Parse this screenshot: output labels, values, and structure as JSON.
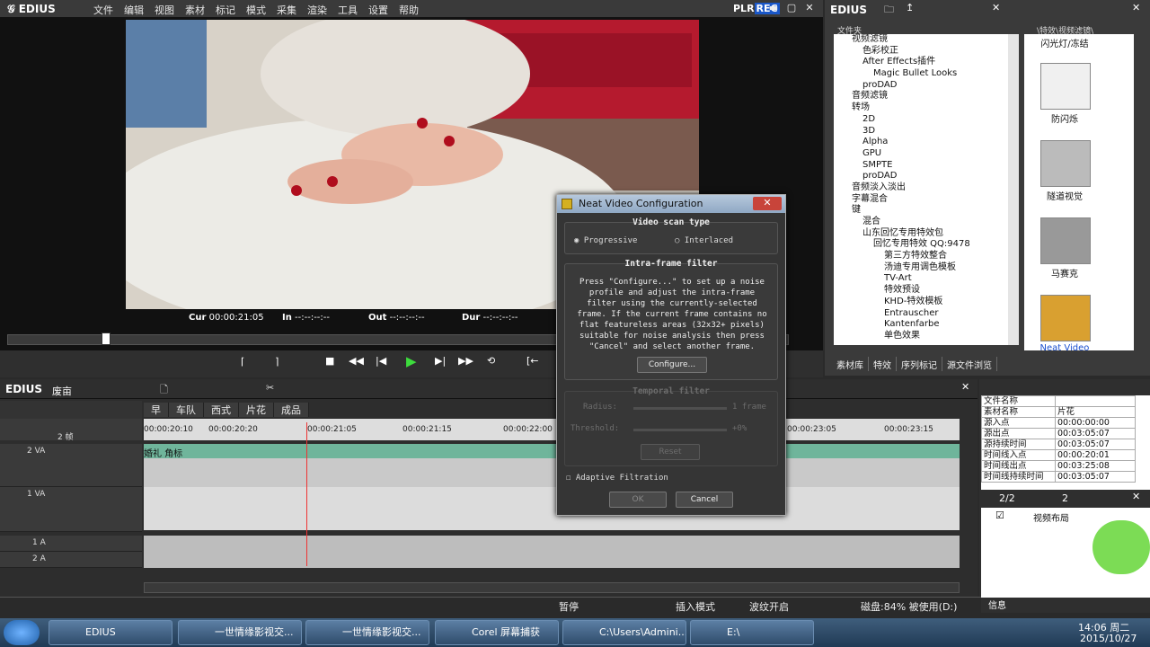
{
  "app": {
    "name": "EDIUS"
  },
  "menu": [
    "文件",
    "编辑",
    "视图",
    "素材",
    "标记",
    "模式",
    "采集",
    "渲染",
    "工具",
    "设置",
    "帮助"
  ],
  "preview": {
    "plr_label": "PLR",
    "rec_label": "REC",
    "cur_label": "Cur",
    "cur_value": "00:00:21:05",
    "in_label": "In",
    "in_value": "--:--:--:--",
    "out_label": "Out",
    "out_value": "--:--:--:--",
    "dur_label": "Dur",
    "dur_value": "--:--:--:--"
  },
  "effects": {
    "title": "EDIUS",
    "folder_header": "文件夹",
    "path_header": "\\特效\\视频滤镜\\",
    "tree": [
      "视频滤镜",
      "色彩校正",
      "After Effects插件",
      "Magic Bullet Looks",
      "proDAD",
      "音频滤镜",
      "转场",
      "2D",
      "3D",
      "Alpha",
      "GPU",
      "SMPTE",
      "proDAD",
      "音频淡入淡出",
      "字幕混合",
      "键",
      "混合",
      "山东回忆专用特效包",
      "回忆专用特效 QQ:9478",
      "第三方特效整合",
      "汤迪专用调色模板",
      "TV-Art",
      "特效预设",
      "KHD-特效模板",
      "Entrauscher",
      "Kantenfarbe",
      "单色效果"
    ],
    "thumbs": [
      "闪光灯/冻结",
      "防闪烁",
      "隧道视觉",
      "马赛克",
      "Neat Video"
    ],
    "tabs": [
      "素材库",
      "特效",
      "序列标记",
      "源文件浏览"
    ]
  },
  "timeline": {
    "title": "EDIUS",
    "project": "废亩",
    "tabs": [
      "早",
      "车队",
      "西式",
      "片花",
      "成品"
    ],
    "ruler": [
      "00:00:20:10",
      "00:00:20:20",
      "00:00:21:05",
      "00:00:21:15",
      "00:00:22:00",
      "00:00:23:05",
      "00:00:23:15"
    ],
    "zoom": "2 帧",
    "tracks": [
      {
        "name": "2 VA"
      },
      {
        "name": "1 VA"
      },
      {
        "name": "1 A"
      },
      {
        "name": "2 A"
      }
    ],
    "clip_label": "婚礼 角标"
  },
  "info": {
    "rows": [
      [
        "文件名称",
        ""
      ],
      [
        "素材名称",
        "片花"
      ],
      [
        "源入点",
        "00:00:00:00"
      ],
      [
        "源出点",
        "00:03:05:07"
      ],
      [
        "源持续时间",
        "00:03:05:07"
      ],
      [
        "时间线入点",
        "00:00:20:01"
      ],
      [
        "时间线出点",
        "00:03:25:08"
      ],
      [
        "时间线持续时间",
        "00:03:05:07"
      ]
    ],
    "count": "2/2",
    "layer_count": "2",
    "layer_label": "视频布局",
    "footer": "信息"
  },
  "status": {
    "state": "暂停",
    "mode": "插入模式",
    "ripple": "波纹开启",
    "disk": "磁盘:84% 被使用(D:)"
  },
  "dialog": {
    "title": "Neat Video Configuration",
    "scan_title": "Video scan type",
    "progressive": "Progressive",
    "interlaced": "Interlaced",
    "intra_title": "Intra-frame filter",
    "intra_text": "Press \"Configure...\" to set up a noise profile and adjust the intra-frame filter using the currently-selected frame. If the current frame contains no flat featureless areas (32x32+ pixels) suitable for noise analysis then press \"Cancel\" and select another frame.",
    "configure": "Configure...",
    "temporal_title": "Temporal filter",
    "radius_label": "Radius:",
    "radius_value": "1 frame",
    "threshold_label": "Threshold:",
    "threshold_value": "+0%",
    "reset": "Reset",
    "adaptive": "Adaptive Filtration",
    "ok": "OK",
    "cancel": "Cancel"
  },
  "taskbar": {
    "items": [
      "EDIUS",
      "一世情缘影视交...",
      "一世情缘影视交...",
      "Corel 屏幕捕获",
      "C:\\Users\\Admini...",
      "E:\\"
    ],
    "time": "14:06 周二",
    "date": "2015/10/27"
  }
}
